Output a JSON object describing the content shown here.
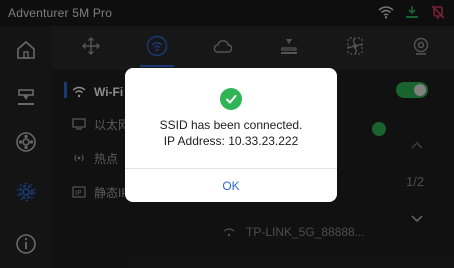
{
  "titlebar": {
    "title": "Adventurer 5M Pro",
    "icons": [
      "wifi-icon",
      "printer-status-icon",
      "camera-status-icon"
    ]
  },
  "sidebar": {
    "items": [
      "home-icon",
      "print-head-icon",
      "filament-spool-icon",
      "settings-gear-icon",
      "info-icon"
    ],
    "active": "settings-gear-icon"
  },
  "topnav": {
    "tabs": [
      "move-axes-icon",
      "wifi-network-icon",
      "cloud-icon",
      "print-bed-icon",
      "fan-icon",
      "camera-icon"
    ],
    "active": "wifi-network-icon"
  },
  "network_menu": {
    "items": [
      {
        "label": "Wi-Fi",
        "icon": "wifi-icon",
        "active": true
      },
      {
        "label": "以太网",
        "icon": "ethernet-icon",
        "active": false
      },
      {
        "label": "热点",
        "icon": "hotspot-icon",
        "active": false
      },
      {
        "label": "静态IP",
        "icon": "static-ip-icon",
        "active": false
      }
    ]
  },
  "wifi_panel": {
    "toggle_on": true,
    "page_indicator": "1/2",
    "network_visible": "TP-LINK_5G_88888..."
  },
  "dialog": {
    "line1": "SSID has been connected.",
    "line2": "IP Address: 10.33.23.222",
    "ok_label": "OK"
  },
  "colors": {
    "accent_blue": "#2e6bd6",
    "success_green": "#2fb456",
    "background": "#1a1a1a"
  }
}
